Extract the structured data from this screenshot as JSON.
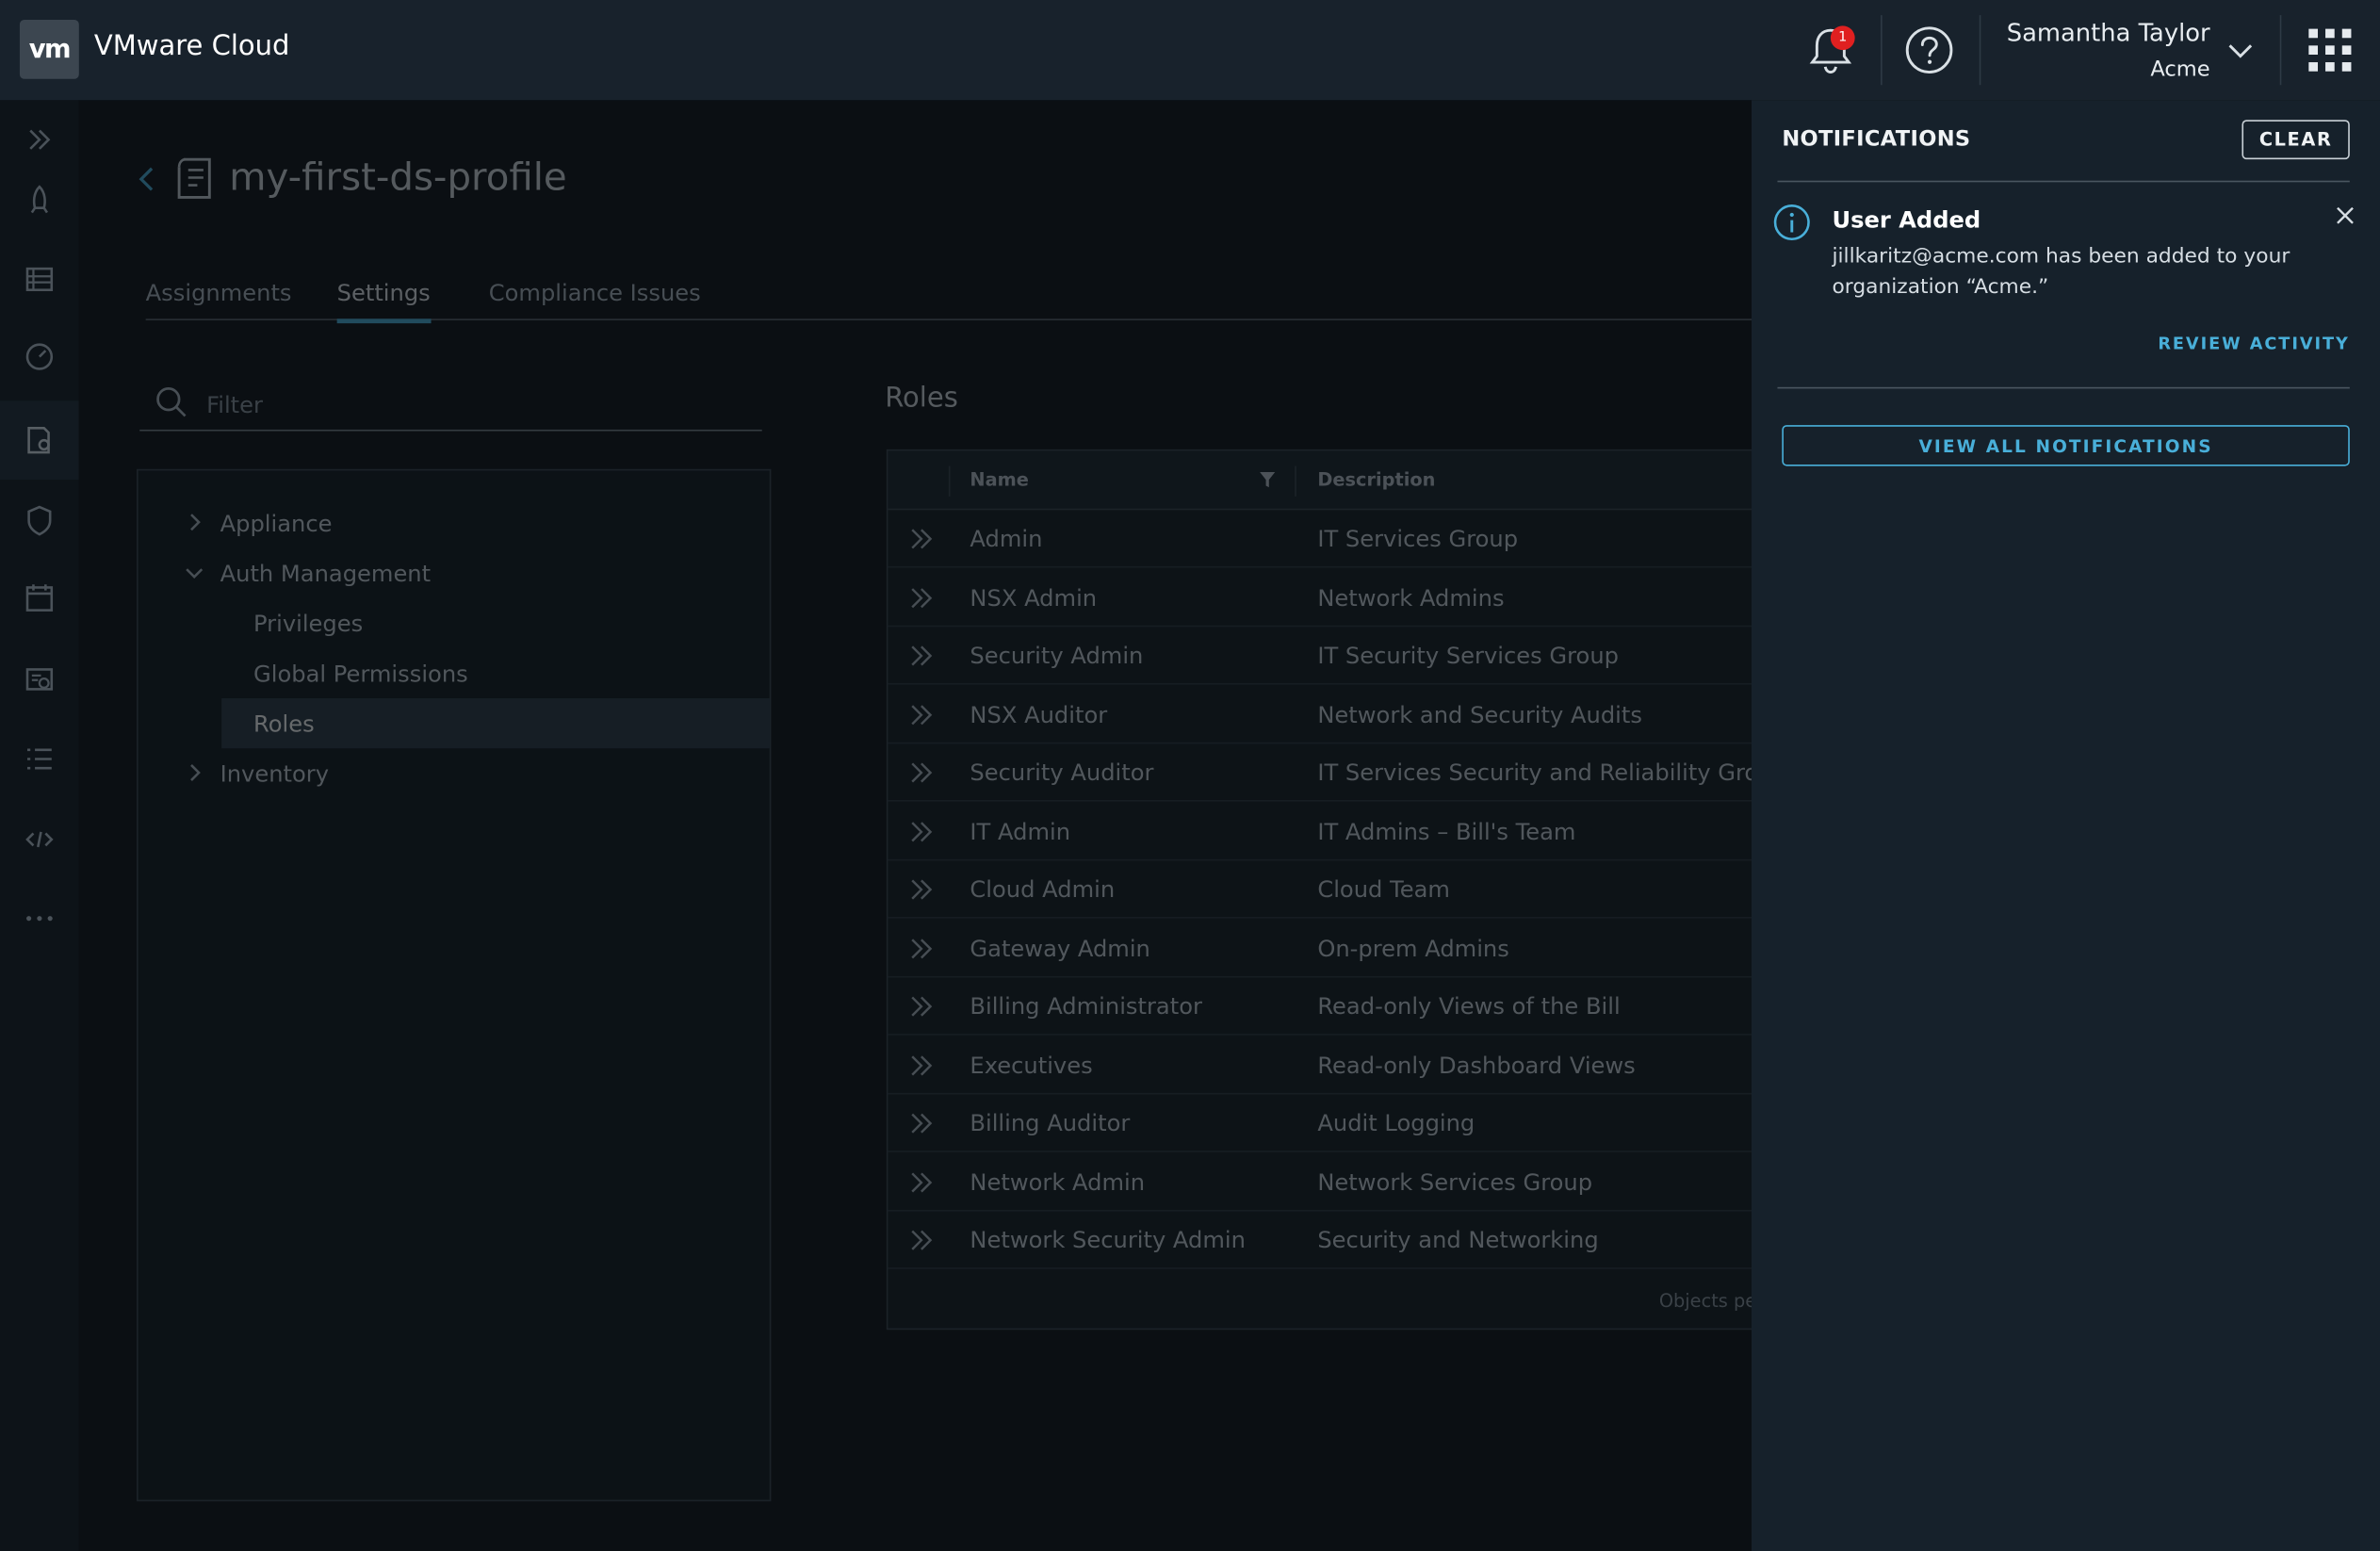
{
  "header": {
    "logo_text": "vm",
    "app_title": "VMware Cloud",
    "notification_count": "1",
    "user_name": "Samantha Taylor",
    "user_org": "Acme"
  },
  "leftnav": {
    "items": [
      "expand-icon",
      "rocket-icon",
      "list-icon",
      "dashboard-icon",
      "profile-settings-icon",
      "shield-icon",
      "calendar-icon",
      "report-icon",
      "menu-list-icon",
      "code-icon",
      "more-icon"
    ],
    "active_index": 4
  },
  "page": {
    "title": "my-first-ds-profile",
    "tabs": [
      {
        "label": "Assignments"
      },
      {
        "label": "Settings"
      },
      {
        "label": "Compliance Issues"
      }
    ],
    "active_tab": "Settings",
    "filter_placeholder": "Filter",
    "tree": [
      {
        "label": "Appliance"
      },
      {
        "label": "Auth Management"
      },
      {
        "label": "Privileges"
      },
      {
        "label": "Global Permissions"
      },
      {
        "label": "Roles"
      },
      {
        "label": "Inventory"
      }
    ],
    "roles_title": "Roles",
    "grid": {
      "col_name": "Name",
      "col_description": "Description",
      "rows": [
        {
          "name": "Admin",
          "description": "IT Services Group"
        },
        {
          "name": "NSX Admin",
          "description": "Network Admins"
        },
        {
          "name": "Security Admin",
          "description": "IT Security Services Group"
        },
        {
          "name": "NSX Auditor",
          "description": "Network and Security Audits"
        },
        {
          "name": "Security Auditor",
          "description": "IT Services Security and Reliability Group"
        },
        {
          "name": "IT Admin",
          "description": "IT Admins – Bill's Team"
        },
        {
          "name": "Cloud Admin",
          "description": "Cloud Team"
        },
        {
          "name": "Gateway Admin",
          "description": "On-prem Admins"
        },
        {
          "name": "Billing Administrator",
          "description": "Read-only Views of the Bill"
        },
        {
          "name": "Executives",
          "description": "Read-only Dashboard Views"
        },
        {
          "name": "Billing Auditor",
          "description": "Audit Logging"
        },
        {
          "name": "Network Admin",
          "description": "Network Services Group"
        },
        {
          "name": "Network Security Admin",
          "description": "Security and Networking"
        }
      ],
      "footer": "Objects pe"
    }
  },
  "notifications": {
    "title": "NOTIFICATIONS",
    "clear_label": "CLEAR",
    "item": {
      "title": "User Added",
      "body": "jillkaritz@acme.com has been added to your organization “Acme.”",
      "action": "REVIEW ACTIVITY"
    },
    "view_all_label": "VIEW ALL NOTIFICATIONS"
  },
  "colors": {
    "accent": "#49afd9",
    "header_bg": "#18222c",
    "panel_bg": "#16212b",
    "badge": "#e02020"
  }
}
